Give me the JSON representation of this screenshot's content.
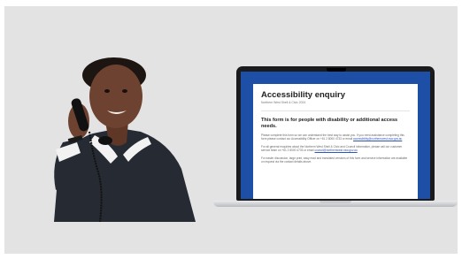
{
  "form": {
    "title": "Accessibility enquiry",
    "subtitle": "Northern West Shell & Civic 2024",
    "heading": "This form is for people with disability or additional access needs.",
    "paragraph_1": "Please complete this form so we can understand the best way to assist you. If you need assistance completing this form please contact our Accessibility Officer on +61 2 8000 4733 or email",
    "paragraph_1_link": "accessibility@northernwest.nsw.gov.au",
    "paragraph_2": "For all general enquiries about the Northern West Shell & Civic and Council information, please call our customer service team on +61 2 8000 4733 or email",
    "paragraph_2_link": "council@northernwest.nsw.gov.au",
    "paragraph_3": "For easier discussion, large print, easy read and translated versions of this form and service information are available on request via the contact details above."
  },
  "colors": {
    "background": "#e3e3e3",
    "screen_blue": "#1d4fa6",
    "laptop_body": "#1b1b1d",
    "sweater": "#262a33",
    "skin": "#6e4230"
  }
}
